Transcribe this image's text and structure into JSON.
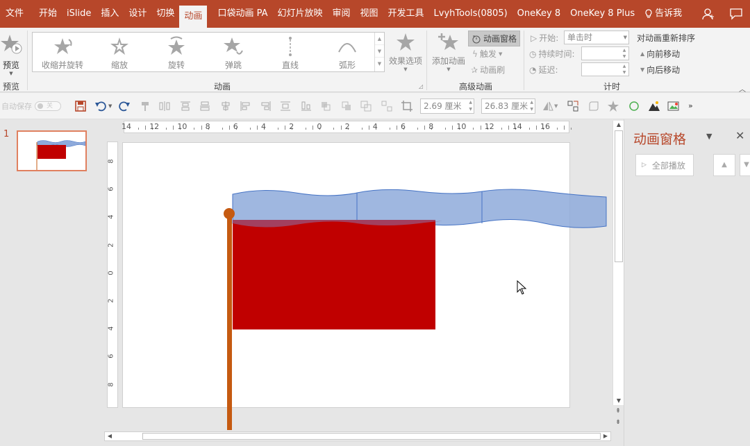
{
  "menu": {
    "items": [
      "文件",
      "开始",
      "iSlide",
      "插入",
      "设计",
      "切换",
      "动画",
      "口袋动画 PA",
      "幻灯片放映",
      "审阅",
      "视图",
      "开发工具",
      "LvyhTools(0805)",
      "OneKey 8",
      "OneKey 8 Plus"
    ],
    "active_index": 6,
    "tell_me": "告诉我"
  },
  "ribbon": {
    "preview": {
      "label": "预览",
      "group": "预览"
    },
    "animation_group": {
      "label": "动画",
      "gallery": [
        "收缩并旋转",
        "缩放",
        "旋转",
        "弹跳",
        "直线",
        "弧形"
      ],
      "effect_options": "效果选项"
    },
    "advanced": {
      "label": "高级动画",
      "add_animation": "添加动画",
      "animation_pane": "动画窗格",
      "trigger": "触发",
      "painter": "动画刷"
    },
    "timing": {
      "label": "计时",
      "start_label": "开始:",
      "start_value": "单击时",
      "duration_label": "持续时间:",
      "delay_label": "延迟:",
      "reorder": "对动画重新排序",
      "move_earlier": "向前移动",
      "move_later": "向后移动"
    }
  },
  "quick_toolbar": {
    "autosave": "自动保存",
    "autosave_state": "关",
    "height": "2.69 厘米",
    "width": "26.83 厘米"
  },
  "thumbnails": {
    "slide_number": "1"
  },
  "rulers": {
    "horizontal": [
      "14",
      "12",
      "10",
      "8",
      "6",
      "4",
      "2",
      "0",
      "2",
      "4",
      "6",
      "8",
      "10",
      "12",
      "14",
      "16"
    ],
    "vertical": [
      "8",
      "6",
      "4",
      "2",
      "0",
      "2",
      "4",
      "6",
      "8"
    ]
  },
  "animation_pane": {
    "title": "动画窗格",
    "play_all": "全部播放"
  },
  "colors": {
    "accent": "#b7472a",
    "flag_red": "#c00000",
    "wave_blue": "#8eaadb",
    "pole": "#c55a11"
  }
}
